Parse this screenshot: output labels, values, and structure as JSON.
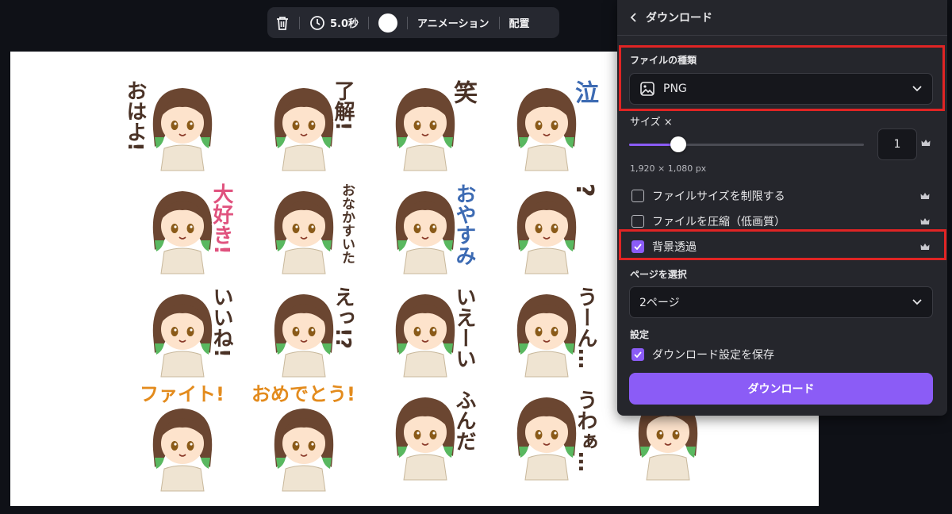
{
  "toolbar": {
    "duration": "5.0秒",
    "animation_label": "アニメーション",
    "position_label": "配置"
  },
  "panel": {
    "title": "ダウンロード",
    "file_type_label": "ファイルの種類",
    "file_type_value": "PNG",
    "size_label": "サイズ ×",
    "size_multiplier": "1",
    "slider_fraction": 0.21,
    "dimensions": "1,920 × 1,080 px",
    "options": [
      {
        "label": "ファイルサイズを制限する",
        "checked": false
      },
      {
        "label": "ファイルを圧縮（低画質）",
        "checked": false
      },
      {
        "label": "背景透過",
        "checked": true
      }
    ],
    "page_select_label": "ページを選択",
    "page_select_value": "2ページ",
    "settings_label": "設定",
    "save_settings_label": "ダウンロード設定を保存",
    "download_button": "ダウンロード",
    "accent_color": "#8b5cf6",
    "highlight_color": "#e02424"
  },
  "stickers": [
    {
      "text": "おはよ!",
      "side": "left"
    },
    {
      "text": "了解!",
      "side": "right"
    },
    {
      "text": "笑",
      "side": "right"
    },
    {
      "text": "泣",
      "side": "right",
      "style": "blue"
    },
    {
      "text": "",
      "side": "right"
    },
    {
      "text": "大好き!",
      "side": "right",
      "style": "pink"
    },
    {
      "text": "おなかすいた",
      "side": "right",
      "style": "small"
    },
    {
      "text": "おやすみ",
      "side": "right",
      "style": "blue"
    },
    {
      "text": "?",
      "side": "right"
    },
    {
      "text": "",
      "side": "right"
    },
    {
      "text": "いいね!",
      "side": "right"
    },
    {
      "text": "えっ!?",
      "side": "right"
    },
    {
      "text": "いえーい",
      "side": "right"
    },
    {
      "text": "うーん…",
      "side": "right"
    },
    {
      "text": "",
      "side": "right"
    },
    {
      "text": "ファイト!",
      "side": "top"
    },
    {
      "text": "おめでとう!",
      "side": "top"
    },
    {
      "text": "ふんだ",
      "side": "right"
    },
    {
      "text": "うわぁ…",
      "side": "right"
    },
    {
      "text": "",
      "side": "right"
    }
  ]
}
